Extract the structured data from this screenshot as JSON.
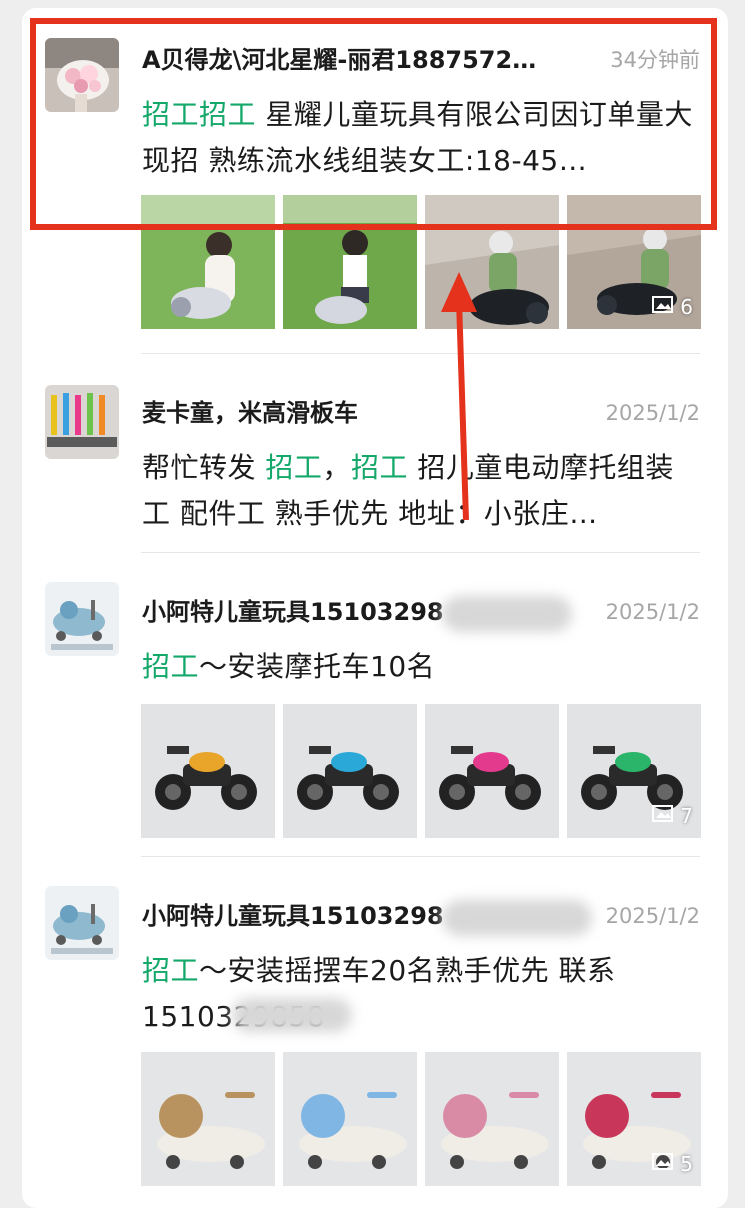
{
  "posts": [
    {
      "name": "A贝得龙\\河北星耀-丽君1887572…",
      "time": "34分钟前",
      "content": [
        {
          "text": "招工招工",
          "tag": true
        },
        {
          "text": " 星耀儿童玩具有限公司因订单量大现招 熟练流水线组装女工:18-45…",
          "tag": false
        }
      ],
      "image_count": "6"
    },
    {
      "name": "麦卡童，米高滑板车",
      "time": "2025/1/2",
      "content": [
        {
          "text": "帮忙转发 ",
          "tag": false
        },
        {
          "text": "招工",
          "tag": true
        },
        {
          "text": "，",
          "tag": false
        },
        {
          "text": "招工",
          "tag": true
        },
        {
          "text": " 招儿童电动摩托组装工 配件工 熟手优先 地址：小张庄…",
          "tag": false
        }
      ]
    },
    {
      "name": "小阿特儿童玩具15103298",
      "time": "2025/1/2",
      "content": [
        {
          "text": "招工",
          "tag": true
        },
        {
          "text": "～安装摩托车10名",
          "tag": false
        }
      ],
      "image_count": "7"
    },
    {
      "name": "小阿特儿童玩具15103298",
      "time": "2025/1/2",
      "content": [
        {
          "text": "招工",
          "tag": true
        },
        {
          "text": "～安装摇摆车20名熟手优先 联系1510329858",
          "tag": false
        }
      ],
      "image_count": "5"
    }
  ],
  "colors": {
    "tag_green": "#14a86a",
    "highlight_red": "#e4321c",
    "time_gray": "#a6a6a6"
  },
  "icons": {
    "image_count": "image-stack-icon"
  }
}
